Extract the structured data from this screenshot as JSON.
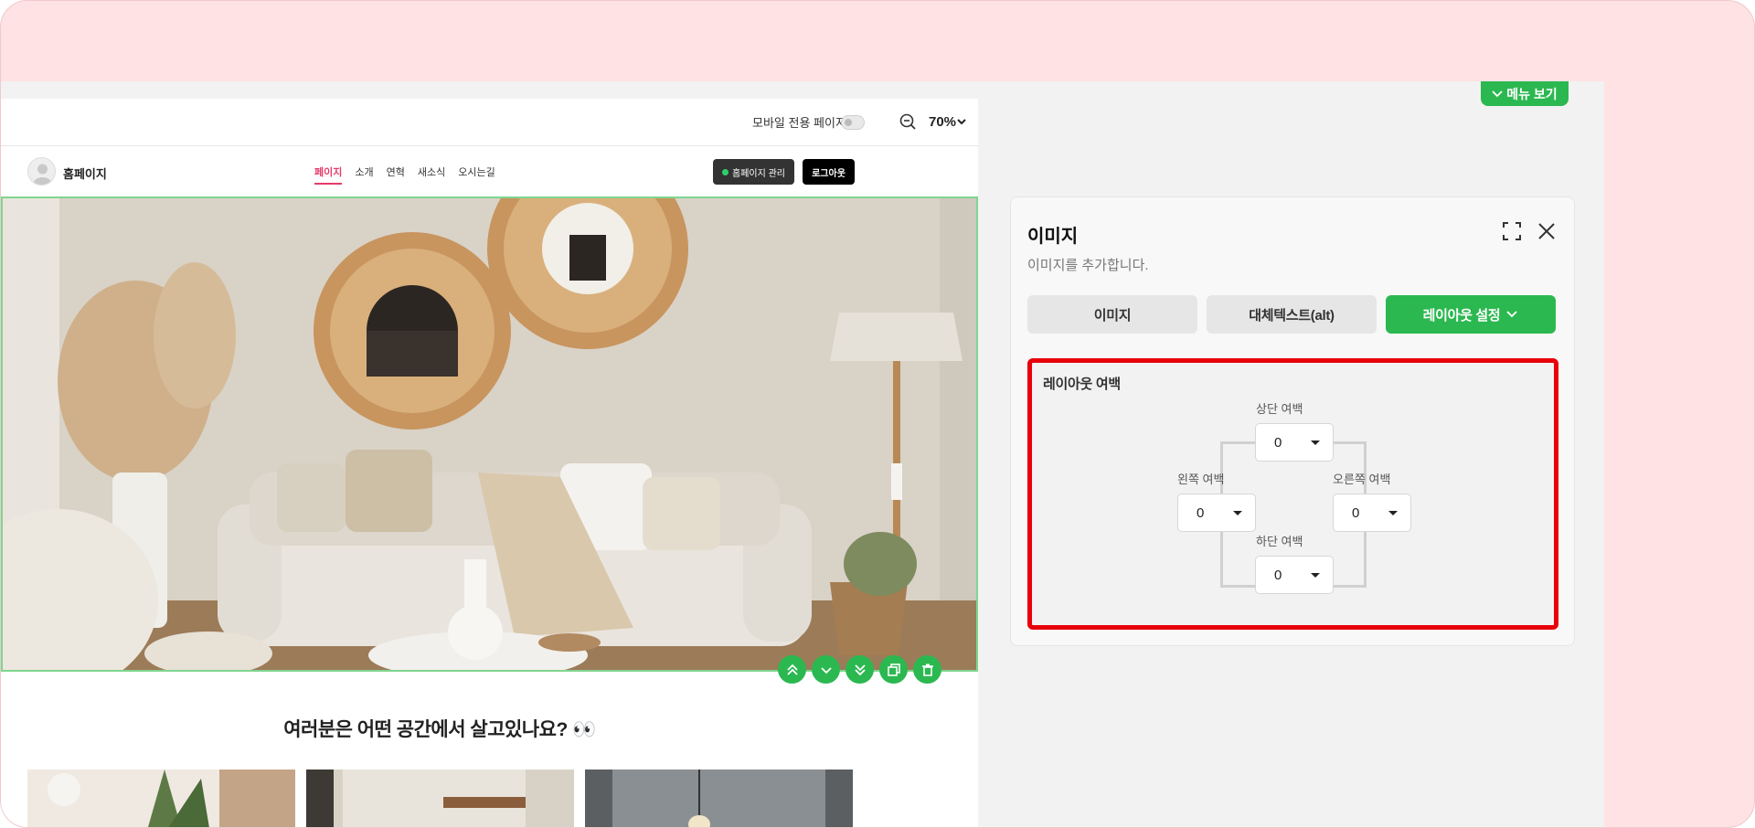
{
  "editor": {
    "mobile_only_label": "모바일 전용 페이지",
    "zoom_value": "70%"
  },
  "site": {
    "name": "홈페이지",
    "nav": [
      "페이지",
      "소개",
      "연혁",
      "새소식",
      "오시는길"
    ],
    "manage_button": "홈페이지 관리",
    "logout_button": "로그아웃",
    "section_title": "여러분은 어떤 공간에서 살고있나요? 👀"
  },
  "menu_toggle": {
    "label": "메뉴 보기"
  },
  "panel": {
    "title": "이미지",
    "subtitle": "이미지를 추가합니다.",
    "tabs": [
      {
        "label": "이미지"
      },
      {
        "label": "대체텍스트(alt)"
      },
      {
        "label": "레이아웃 설정"
      }
    ],
    "layout": {
      "title": "레이아웃 여백",
      "top": {
        "label": "상단 여백",
        "value": "0"
      },
      "left": {
        "label": "왼쪽 여백",
        "value": "0"
      },
      "right": {
        "label": "오른쪽 여백",
        "value": "0"
      },
      "bottom": {
        "label": "하단 여백",
        "value": "0"
      }
    }
  },
  "colors": {
    "accent": "#2cb850",
    "highlight": "#e8000b",
    "nav_active": "#e63c68",
    "background": "#ffe2e4"
  }
}
